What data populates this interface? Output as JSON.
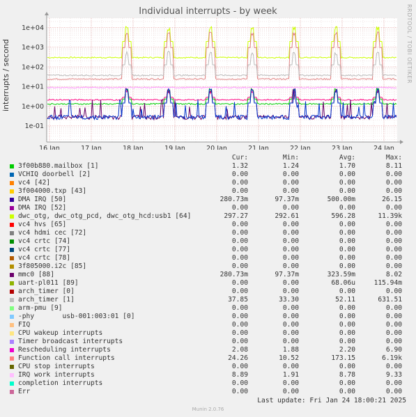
{
  "chart_data": {
    "type": "line",
    "title": "Individual interrupts - by week",
    "ylabel": "interrupts / second",
    "y_scale": "log",
    "ylim": [
      0.015,
      30000
    ],
    "y_ticks": [
      {
        "value": 10000,
        "label": "1e+04"
      },
      {
        "value": 1000,
        "label": "1e+03"
      },
      {
        "value": 100,
        "label": "1e+02"
      },
      {
        "value": 10,
        "label": "1e+01"
      },
      {
        "value": 1,
        "label": "1e+00"
      },
      {
        "value": 0.1,
        "label": "1e-01"
      }
    ],
    "x_ticks": [
      "16 Jan",
      "17 Jan",
      "18 Jan",
      "19 Jan",
      "20 Jan",
      "21 Jan",
      "22 Jan",
      "23 Jan",
      "24 Jan"
    ],
    "x_range": [
      "2025-01-15T16:00",
      "2025-01-24T18:00"
    ],
    "grid": true,
    "series": [
      {
        "name": "dwc_otg, dwc_otg_pcd, dwc_otg_hcd:usb1 [64]",
        "color": "#ccff00",
        "baseline": 297,
        "spike": 11390
      },
      {
        "name": "Function call interrupts",
        "color": "#e08080",
        "baseline": 24,
        "spike": 6190
      },
      {
        "name": "IRQ work interrupts",
        "color": "#ff99ff",
        "baseline": 8.8,
        "spike": 9.3
      },
      {
        "name": "arch_timer [1]",
        "color": "#bbbbbb",
        "baseline": 37,
        "spike": 630
      },
      {
        "name": "Rescheduling interrupts",
        "color": "#ff1188",
        "baseline": 2.1,
        "spike": 6.9
      },
      {
        "name": "3f00b880.mailbox [1]",
        "color": "#00cc00",
        "baseline": 1.3,
        "spike": 8.1
      },
      {
        "name": "mmc0 [88]",
        "color": "#660066",
        "baseline": 0.28,
        "spike": 8.0
      },
      {
        "name": "DMA IRQ [50]",
        "color": "#0033cc",
        "baseline": 0.28,
        "spike": 8.0
      }
    ],
    "legend_headers": {
      "cur": "Cur:",
      "min": "Min:",
      "avg": "Avg:",
      "max": "Max:"
    },
    "legend": [
      {
        "name": "3f00b880.mailbox [1]",
        "color": "#00cc00",
        "cur": "1.32",
        "min": "1.24",
        "avg": "1.70",
        "max": "8.11"
      },
      {
        "name": "VCHIQ doorbell [2]",
        "color": "#0066b3",
        "cur": "0.00",
        "min": "0.00",
        "avg": "0.00",
        "max": "0.00"
      },
      {
        "name": "vc4 [42]",
        "color": "#ff8000",
        "cur": "0.00",
        "min": "0.00",
        "avg": "0.00",
        "max": "0.00"
      },
      {
        "name": "3f004000.txp [43]",
        "color": "#ffcc00",
        "cur": "0.00",
        "min": "0.00",
        "avg": "0.00",
        "max": "0.00"
      },
      {
        "name": "DMA IRQ [50]",
        "color": "#330099",
        "cur": "280.73m",
        "min": "97.37m",
        "avg": "500.00m",
        "max": "26.15"
      },
      {
        "name": "DMA IRQ [52]",
        "color": "#990099",
        "cur": "0.00",
        "min": "0.00",
        "avg": "0.00",
        "max": "0.00"
      },
      {
        "name": "dwc_otg, dwc_otg_pcd, dwc_otg_hcd:usb1 [64]",
        "color": "#ccff00",
        "cur": "297.27",
        "min": "292.61",
        "avg": "596.28",
        "max": "11.39k"
      },
      {
        "name": "vc4 hvs [65]",
        "color": "#ff0000",
        "cur": "0.00",
        "min": "0.00",
        "avg": "0.00",
        "max": "0.00"
      },
      {
        "name": "vc4 hdmi cec [72]",
        "color": "#808080",
        "cur": "0.00",
        "min": "0.00",
        "avg": "0.00",
        "max": "0.00"
      },
      {
        "name": "vc4 crtc [74]",
        "color": "#008f00",
        "cur": "0.00",
        "min": "0.00",
        "avg": "0.00",
        "max": "0.00"
      },
      {
        "name": "vc4 crtc [77]",
        "color": "#00487d",
        "cur": "0.00",
        "min": "0.00",
        "avg": "0.00",
        "max": "0.00"
      },
      {
        "name": "vc4 crtc [78]",
        "color": "#b35a00",
        "cur": "0.00",
        "min": "0.00",
        "avg": "0.00",
        "max": "0.00"
      },
      {
        "name": "3f805000.i2c [85]",
        "color": "#b38f00",
        "cur": "0.00",
        "min": "0.00",
        "avg": "0.00",
        "max": "0.00"
      },
      {
        "name": "mmc0 [88]",
        "color": "#6b006b",
        "cur": "280.73m",
        "min": "97.37m",
        "avg": "323.59m",
        "max": "8.02"
      },
      {
        "name": "uart-pl011 [89]",
        "color": "#8fb300",
        "cur": "0.00",
        "min": "0.00",
        "avg": "68.06u",
        "max": "115.94m"
      },
      {
        "name": "arch_timer [0]",
        "color": "#b30000",
        "cur": "0.00",
        "min": "0.00",
        "avg": "0.00",
        "max": "0.00"
      },
      {
        "name": "arch_timer [1]",
        "color": "#bebebe",
        "cur": "37.85",
        "min": "33.30",
        "avg": "52.11",
        "max": "631.51"
      },
      {
        "name": "arm-pmu [9]",
        "color": "#80ff80",
        "cur": "0.00",
        "min": "0.00",
        "avg": "0.00",
        "max": "0.00"
      },
      {
        "name": "-phy       usb-001:003:01 [0]",
        "color": "#80c9ff",
        "cur": "0.00",
        "min": "0.00",
        "avg": "0.00",
        "max": "0.00"
      },
      {
        "name": "FIQ",
        "color": "#ffc080",
        "cur": "0.00",
        "min": "0.00",
        "avg": "0.00",
        "max": "0.00"
      },
      {
        "name": "CPU wakeup interrupts",
        "color": "#ffe680",
        "cur": "0.00",
        "min": "0.00",
        "avg": "0.00",
        "max": "0.00"
      },
      {
        "name": "Timer broadcast interrupts",
        "color": "#aa80ff",
        "cur": "0.00",
        "min": "0.00",
        "avg": "0.00",
        "max": "0.00"
      },
      {
        "name": "Rescheduling interrupts",
        "color": "#ee00cc",
        "cur": "2.08",
        "min": "1.88",
        "avg": "2.20",
        "max": "6.90"
      },
      {
        "name": "Function call interrupts",
        "color": "#ff8080",
        "cur": "24.26",
        "min": "10.52",
        "avg": "173.15",
        "max": "6.19k"
      },
      {
        "name": "CPU stop interrupts",
        "color": "#666600",
        "cur": "0.00",
        "min": "0.00",
        "avg": "0.00",
        "max": "0.00"
      },
      {
        "name": "IRQ work interrupts",
        "color": "#ffbfff",
        "cur": "8.89",
        "min": "1.91",
        "avg": "8.78",
        "max": "9.33"
      },
      {
        "name": "completion interrupts",
        "color": "#00ffcc",
        "cur": "0.00",
        "min": "0.00",
        "avg": "0.00",
        "max": "0.00"
      },
      {
        "name": "Err",
        "color": "#cc6699",
        "cur": "0.00",
        "min": "0.00",
        "avg": "0.00",
        "max": "0.00"
      }
    ],
    "last_update": "Last update: Fri Jan 24 18:00:21 2025"
  },
  "side_credit": "RRDTOOL / TOBI OETIKER",
  "footer": "Munin 2.0.76"
}
